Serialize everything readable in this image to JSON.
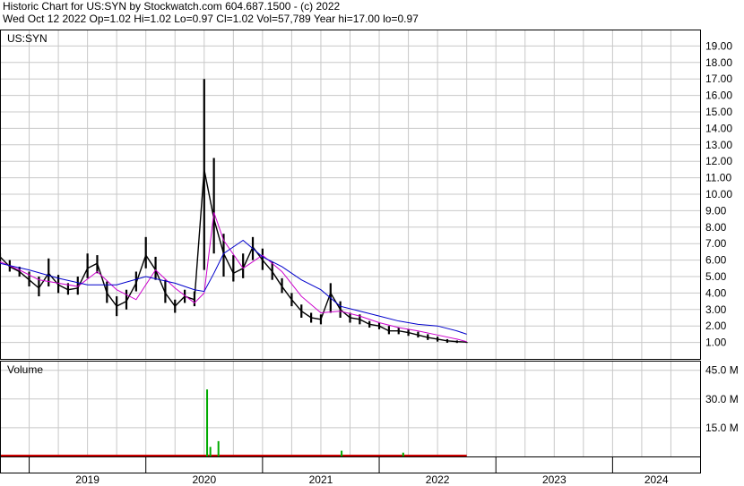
{
  "header": {
    "line1": "Historic Chart for US:SYN by Stockwatch.com 604.687.1500 - (c) 2022",
    "line2": "Wed Oct 12 2022  Op=1.02  Hi=1.02  Lo=0.97  Cl=1.02  Vol=57,789  Year hi=17.00  lo=0.97"
  },
  "colors": {
    "price": "#000000",
    "ma_short": "#cc00cc",
    "ma_long": "#0000cc",
    "volume_up": "#00aa00",
    "volume_down": "#cc0000",
    "grid": "#c8c8c8"
  },
  "chart_data": [
    {
      "type": "line",
      "title": "US:SYN",
      "ylim": [
        0,
        20
      ],
      "y_ticks": [
        "1.00",
        "2.00",
        "3.00",
        "4.00",
        "5.00",
        "6.00",
        "7.00",
        "8.00",
        "9.00",
        "10.00",
        "11.00",
        "12.00",
        "13.00",
        "14.00",
        "15.00",
        "16.00",
        "17.00",
        "18.00",
        "19.00"
      ],
      "x_labels": [
        "2019",
        "2020",
        "2021",
        "2022",
        "2023",
        "2024"
      ],
      "xlim": [
        "2018-10",
        "2024-10"
      ],
      "grid": true,
      "series": [
        {
          "role": "price",
          "x": [
            "2018-10",
            "2018-11",
            "2018-12",
            "2019-01",
            "2019-02",
            "2019-03",
            "2019-04",
            "2019-05",
            "2019-06",
            "2019-07",
            "2019-08",
            "2019-09",
            "2019-10",
            "2019-11",
            "2019-12",
            "2020-01",
            "2020-02",
            "2020-03",
            "2020-04",
            "2020-05",
            "2020-06",
            "2020-07",
            "2020-08",
            "2020-09",
            "2020-10",
            "2020-11",
            "2020-12",
            "2021-01",
            "2021-02",
            "2021-03",
            "2021-04",
            "2021-05",
            "2021-06",
            "2021-07",
            "2021-08",
            "2021-09",
            "2021-10",
            "2021-11",
            "2021-12",
            "2022-01",
            "2022-02",
            "2022-03",
            "2022-04",
            "2022-05",
            "2022-06",
            "2022-07",
            "2022-08",
            "2022-09",
            "2022-10"
          ],
          "y": [
            6.2,
            5.6,
            5.3,
            4.8,
            4.3,
            5.2,
            4.5,
            4.2,
            4.3,
            5.5,
            5.8,
            4.0,
            3.2,
            3.5,
            4.6,
            6.3,
            5.4,
            4.0,
            3.2,
            3.8,
            3.6,
            11.5,
            8.5,
            6.4,
            5.2,
            5.5,
            6.8,
            6.0,
            5.3,
            4.4,
            3.6,
            2.9,
            2.5,
            2.4,
            4.0,
            3.0,
            2.5,
            2.4,
            2.1,
            2.0,
            1.7,
            1.7,
            1.6,
            1.45,
            1.3,
            1.2,
            1.1,
            1.05,
            1.02
          ],
          "high": [
            6.4,
            6.0,
            5.6,
            5.3,
            5.0,
            6.1,
            5.1,
            4.6,
            5.0,
            6.4,
            6.3,
            4.7,
            3.8,
            4.2,
            5.3,
            7.4,
            6.2,
            4.8,
            3.6,
            4.2,
            4.1,
            17.0,
            12.2,
            7.6,
            6.3,
            6.4,
            7.4,
            6.7,
            5.9,
            4.9,
            4.0,
            3.3,
            2.8,
            2.7,
            4.6,
            3.5,
            2.8,
            2.7,
            2.3,
            2.2,
            2.0,
            1.9,
            1.8,
            1.65,
            1.5,
            1.35,
            1.2,
            1.12,
            1.02
          ],
          "low": [
            5.9,
            5.3,
            5.0,
            4.4,
            3.8,
            4.4,
            4.0,
            3.9,
            3.9,
            4.9,
            5.2,
            3.4,
            2.6,
            3.0,
            4.1,
            5.5,
            4.8,
            3.4,
            2.8,
            3.4,
            3.2,
            5.4,
            6.4,
            5.0,
            4.7,
            4.9,
            6.0,
            5.4,
            4.8,
            4.0,
            3.2,
            2.5,
            2.2,
            2.1,
            2.8,
            2.5,
            2.2,
            2.1,
            1.9,
            1.8,
            1.5,
            1.5,
            1.4,
            1.3,
            1.15,
            1.05,
            0.98,
            0.97,
            0.97
          ]
        },
        {
          "role": "ma_short",
          "x": [
            "2018-10",
            "2018-12",
            "2019-02",
            "2019-04",
            "2019-06",
            "2019-08",
            "2019-10",
            "2019-12",
            "2020-02",
            "2020-04",
            "2020-06",
            "2020-07",
            "2020-08",
            "2020-09",
            "2020-11",
            "2021-01",
            "2021-03",
            "2021-05",
            "2021-07",
            "2021-09",
            "2021-11",
            "2022-01",
            "2022-03",
            "2022-05",
            "2022-07",
            "2022-09",
            "2022-10"
          ],
          "y": [
            5.9,
            5.4,
            4.8,
            4.6,
            4.4,
            5.3,
            4.2,
            3.6,
            5.4,
            4.3,
            3.4,
            4.0,
            8.9,
            7.2,
            5.5,
            6.3,
            5.3,
            3.8,
            2.8,
            2.9,
            2.6,
            2.2,
            1.9,
            1.7,
            1.45,
            1.2,
            1.05
          ]
        },
        {
          "role": "ma_long",
          "x": [
            "2018-10",
            "2019-01",
            "2019-04",
            "2019-07",
            "2019-10",
            "2020-01",
            "2020-04",
            "2020-06",
            "2020-07",
            "2020-08",
            "2020-09",
            "2020-11",
            "2021-01",
            "2021-03",
            "2021-05",
            "2021-07",
            "2021-09",
            "2021-11",
            "2022-01",
            "2022-03",
            "2022-05",
            "2022-07",
            "2022-09",
            "2022-10"
          ],
          "y": [
            5.8,
            5.4,
            4.9,
            4.5,
            4.5,
            5.0,
            4.6,
            4.2,
            4.1,
            5.2,
            6.4,
            7.2,
            6.2,
            5.6,
            4.8,
            4.2,
            3.2,
            2.9,
            2.6,
            2.3,
            2.1,
            2.0,
            1.7,
            1.5
          ]
        }
      ]
    },
    {
      "type": "bar",
      "title": "Volume",
      "ylim": [
        0,
        50
      ],
      "y_ticks": [
        "15.0 M",
        "30.0 M",
        "45.0 M"
      ],
      "x": [
        "2020-07-10",
        "2020-07-20",
        "2020-08-15",
        "2021-09-05",
        "2022-03-15"
      ],
      "values": [
        35,
        5,
        8,
        3,
        2
      ],
      "grid": true
    }
  ]
}
